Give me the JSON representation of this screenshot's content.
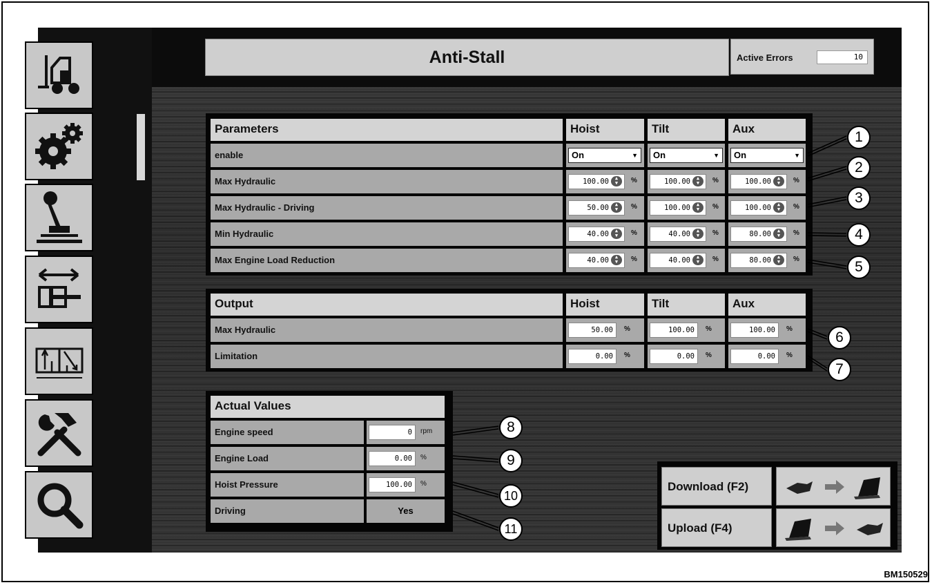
{
  "title": "Anti-Stall",
  "active_errors": {
    "label": "Active Errors",
    "value": "10"
  },
  "nav_icons": [
    "forklift-icon",
    "gears-icon",
    "joystick-icon",
    "hydraulic-cylinder-icon",
    "valve-icon",
    "tools-icon",
    "search-icon"
  ],
  "parameters": {
    "headers": [
      "Parameters",
      "Hoist",
      "Tilt",
      "Aux"
    ],
    "enable_label": "enable",
    "enable_values": [
      "On",
      "On",
      "On"
    ],
    "rows": [
      {
        "label": "Max Hydraulic",
        "values": [
          "100.00",
          "100.00",
          "100.00"
        ]
      },
      {
        "label": "Max Hydraulic - Driving",
        "values": [
          "50.00",
          "100.00",
          "100.00"
        ]
      },
      {
        "label": "Min Hydraulic",
        "values": [
          "40.00",
          "40.00",
          "80.00"
        ]
      },
      {
        "label": "Max Engine Load Reduction",
        "values": [
          "40.00",
          "40.00",
          "80.00"
        ]
      }
    ],
    "unit": "%"
  },
  "output": {
    "headers": [
      "Output",
      "Hoist",
      "Tilt",
      "Aux"
    ],
    "rows": [
      {
        "label": "Max Hydraulic",
        "values": [
          "50.00",
          "100.00",
          "100.00"
        ]
      },
      {
        "label": "Limitation",
        "values": [
          "0.00",
          "0.00",
          "0.00"
        ]
      }
    ],
    "unit": "%"
  },
  "actual_values": {
    "header": "Actual Values",
    "rows": [
      {
        "label": "Engine speed",
        "value": "0",
        "unit": "rpm"
      },
      {
        "label": "Engine Load",
        "value": "0.00",
        "unit": "%"
      },
      {
        "label": "Hoist Pressure",
        "value": "100.00",
        "unit": "%"
      },
      {
        "label": "Driving",
        "value": "Yes",
        "unit": ""
      }
    ]
  },
  "actions": {
    "download_label": "Download (F2)",
    "upload_label": "Upload (F4)"
  },
  "callouts": [
    "1",
    "2",
    "3",
    "4",
    "5",
    "6",
    "7",
    "8",
    "9",
    "10",
    "11"
  ],
  "figure_code": "BM150529"
}
